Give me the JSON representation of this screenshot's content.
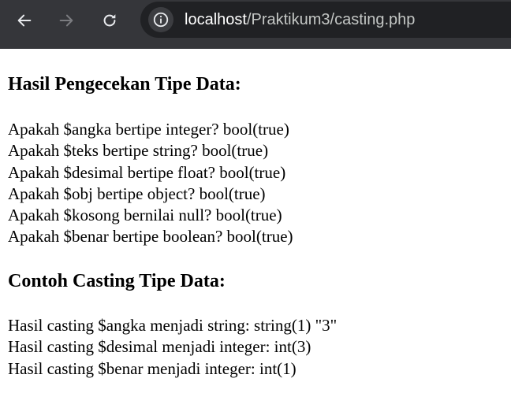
{
  "browser": {
    "url_host": "localhost",
    "url_path": "/Praktikum3/casting.php"
  },
  "page": {
    "heading_check": "Hasil Pengecekan Tipe Data:",
    "check_lines": [
      "Apakah $angka bertipe integer? bool(true)",
      "Apakah $teks bertipe string? bool(true)",
      "Apakah $desimal bertipe float? bool(true)",
      "Apakah $obj bertipe object? bool(true)",
      "Apakah $kosong bernilai null? bool(true)",
      "Apakah $benar bertipe boolean? bool(true)"
    ],
    "heading_casting": "Contoh Casting Tipe Data:",
    "casting_lines": [
      "Hasil casting $angka menjadi string: string(1) \"3\"",
      "Hasil casting $desimal menjadi integer: int(3)",
      "Hasil casting $benar menjadi integer: int(1)"
    ]
  }
}
